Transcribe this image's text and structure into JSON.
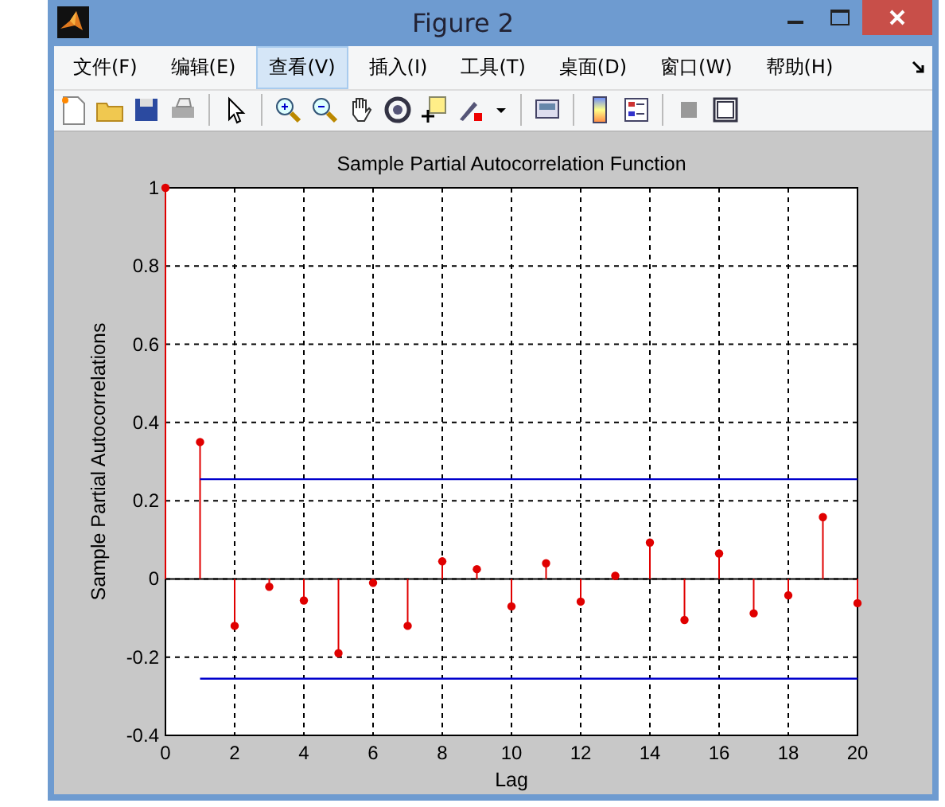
{
  "window": {
    "title": "Figure 2"
  },
  "menu": [
    {
      "label": "文件(F)",
      "selected": false
    },
    {
      "label": "编辑(E)",
      "selected": false
    },
    {
      "label": "查看(V)",
      "selected": true
    },
    {
      "label": "插入(I)",
      "selected": false
    },
    {
      "label": "工具(T)",
      "selected": false
    },
    {
      "label": "桌面(D)",
      "selected": false
    },
    {
      "label": "窗口(W)",
      "selected": false
    },
    {
      "label": "帮助(H)",
      "selected": false
    }
  ],
  "chart_data": {
    "type": "scatter",
    "title": "Sample Partial Autocorrelation Function",
    "xlabel": "Lag",
    "ylabel": "Sample Partial Autocorrelations",
    "x": [
      0,
      1,
      2,
      3,
      4,
      5,
      6,
      7,
      8,
      9,
      10,
      11,
      12,
      13,
      14,
      15,
      16,
      17,
      18,
      19,
      20
    ],
    "series": [
      {
        "color": "#e00000",
        "values": [
          1,
          0.35,
          -0.12,
          -0.02,
          -0.055,
          -0.19,
          -0.01,
          -0.12,
          0.045,
          0.025,
          -0.07,
          0.04,
          -0.058,
          0.008,
          0.093,
          -0.105,
          0.065,
          -0.088,
          -0.042,
          0.158,
          -0.062
        ]
      },
      {
        "type": "line",
        "color": "#0000cc",
        "values": [
          null,
          0.255,
          0.255,
          0.255,
          0.255,
          0.255,
          0.255,
          0.255,
          0.255,
          0.255,
          0.255,
          0.255,
          0.255,
          0.255,
          0.255,
          0.255,
          0.255,
          0.255,
          0.255,
          0.255,
          0.255
        ]
      },
      {
        "type": "line",
        "color": "#0000cc",
        "values": [
          null,
          -0.255,
          -0.255,
          -0.255,
          -0.255,
          -0.255,
          -0.255,
          -0.255,
          -0.255,
          -0.255,
          -0.255,
          -0.255,
          -0.255,
          -0.255,
          -0.255,
          -0.255,
          -0.255,
          -0.255,
          -0.255,
          -0.255,
          -0.255
        ]
      }
    ],
    "xlim": [
      0,
      20
    ],
    "ylim": [
      -0.4,
      1
    ],
    "xticks": [
      0,
      2,
      4,
      6,
      8,
      10,
      12,
      14,
      16,
      18,
      20
    ],
    "yticks": [
      {
        "value": -0.4,
        "label": "-0.4"
      },
      {
        "value": -0.2,
        "label": "-0.2"
      },
      {
        "value": 0,
        "label": "0"
      },
      {
        "value": 0.2,
        "label": "0.2"
      },
      {
        "value": 0.4,
        "label": "0.4"
      },
      {
        "value": 0.6,
        "label": "0.6"
      },
      {
        "value": 0.8,
        "label": "0.8"
      },
      {
        "value": 1,
        "label": "1"
      }
    ],
    "grid": true
  }
}
